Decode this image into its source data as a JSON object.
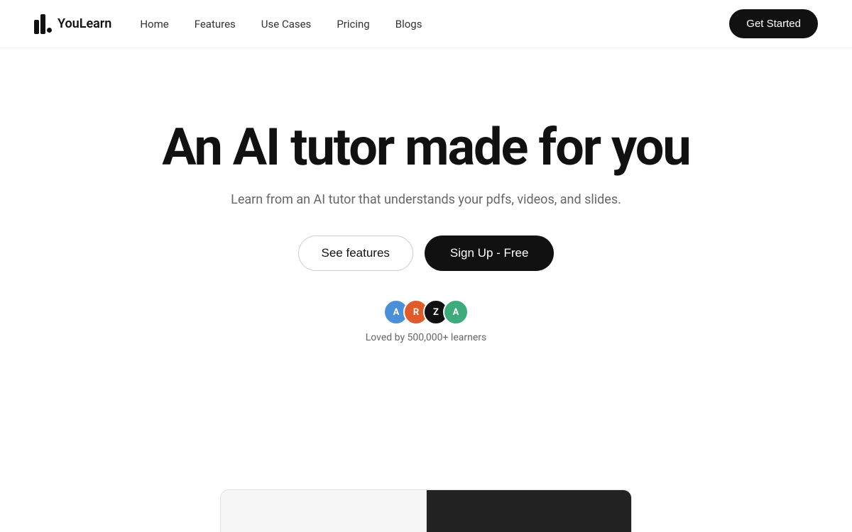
{
  "brand": {
    "name": "YouLearn",
    "logo_alt": "YouLearn logo"
  },
  "nav": {
    "links": [
      {
        "label": "Home",
        "href": "#"
      },
      {
        "label": "Features",
        "href": "#"
      },
      {
        "label": "Use Cases",
        "href": "#"
      },
      {
        "label": "Pricing",
        "href": "#"
      },
      {
        "label": "Blogs",
        "href": "#"
      }
    ],
    "cta_label": "Get Started"
  },
  "hero": {
    "title": "An AI tutor made for you",
    "subtitle": "Learn from an AI tutor that understands your pdfs, videos, and slides.",
    "btn_secondary": "See features",
    "btn_primary": "Sign Up - Free"
  },
  "social_proof": {
    "avatars": [
      {
        "letter": "A",
        "class": "avatar-a1"
      },
      {
        "letter": "R",
        "class": "avatar-r"
      },
      {
        "letter": "Z",
        "class": "avatar-z"
      },
      {
        "letter": "A",
        "class": "avatar-a2"
      }
    ],
    "text": "Loved by 500,000+ learners"
  }
}
